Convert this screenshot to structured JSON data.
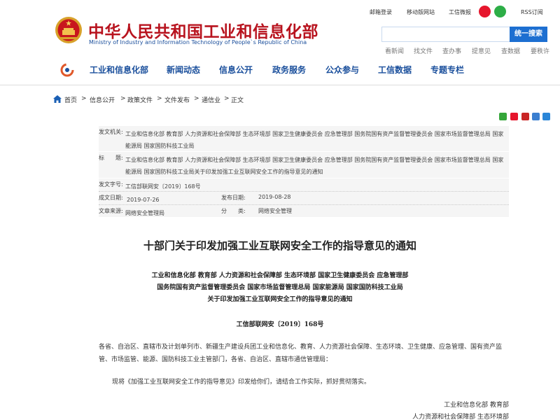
{
  "header": {
    "title_cn": "中华人民共和国工业和信息化部",
    "title_en": "Ministry of Industry and Information Technology of People`s Republic of China",
    "top_links": {
      "mail_login": "邮箱登录",
      "mobile_site": "移动版网站",
      "weibo": "工信微报",
      "rss": "RSS订阅"
    },
    "search": {
      "placeholder": "",
      "button": "统一搜索"
    },
    "quick_links": [
      "看新闻",
      "找文件",
      "查办事",
      "提意见",
      "查数据",
      "要秩许"
    ],
    "nav": [
      "工业和信息化部",
      "新闻动态",
      "信息公开",
      "政务服务",
      "公众参与",
      "工信数据",
      "专题专栏"
    ]
  },
  "breadcrumb": [
    "首页",
    "信息公开",
    "政策文件",
    "文件发布",
    "通信业",
    "正文"
  ],
  "breadcrumb_sep": ">",
  "meta": {
    "issuer_label": "发文机关:",
    "issuer": "工业和信息化部 教育部 人力资源和社会保障部 生态环境部 国家卫生健康委员会 应急管理部 国务院国有资产监督管理委员会 国家市场监督管理总局 国家能源局 国家国防科技工业局",
    "subject_label": "标　　题:",
    "subject": "工业和信息化部 教育部 人力资源和社会保障部 生态环境部 国家卫生健康委员会 应急管理部 国务院国有资产监督管理委员会 国家市场监督管理总局 国家能源局 国家国防科技工业局关于印发加强工业互联网安全工作的指导意见的通知",
    "docno_label": "发文字号:",
    "docno": "工信部联网安〔2019〕168号",
    "created_label": "成文日期:",
    "created": "2019-07-26",
    "published_label": "发布日期:",
    "published": "2019-08-28",
    "source_label": "文章来源:",
    "source": "网络安全管理局",
    "category_label": "分　　类:",
    "category": "网络安全管理"
  },
  "article": {
    "title": "十部门关于印发加强工业互联网安全工作的指导意见的通知",
    "recipients_lines": [
      "工业和信息化部 教育部 人力资源和社会保障部 生态环境部 国家卫生健康委员会 应急管理部",
      "国务院国有资产监督管理委员会 国家市场监督管理总局 国家能源局 国家国防科技工业局",
      "关于印发加强工业互联网安全工作的指导意见的通知"
    ],
    "doc_number": "工信部联网安〔2019〕168号",
    "paragraph1": "各省、自治区、直辖市及计划单列市、新疆生产建设兵团工业和信息化、教育、人力资源社会保障、生态环境、卫生健康、应急管理、国有资产监管、市场监管、能源、国防科技工业主管部门，各省、自治区、直辖市通信管理局：",
    "paragraph2": "现将《加强工业互联网安全工作的指导意见》印发给你们，请结合工作实际，抓好贯彻落实。",
    "signatures": [
      "工业和信息化部 教育部",
      "人力资源和社会保障部 生态环境部"
    ]
  },
  "colors": {
    "brand_red": "#b8131e",
    "nav_blue": "#1a4f9c",
    "search_blue": "#1d6fd1"
  }
}
